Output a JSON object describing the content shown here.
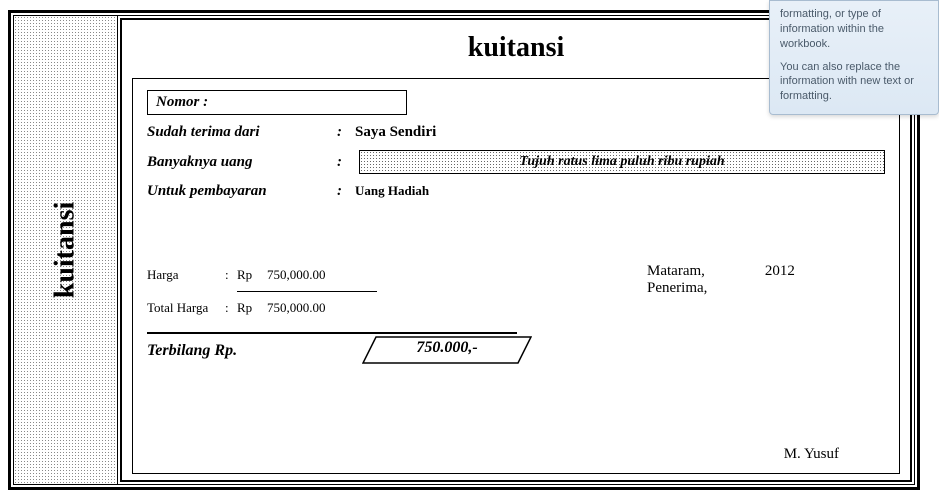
{
  "tooltip": {
    "line1": "formatting, or type of information within the workbook.",
    "line2": "You can also replace the information with new text or formatting."
  },
  "spine": {
    "title": "kuitansi"
  },
  "receipt": {
    "title": "kuitansi",
    "nomor_label": "Nomor :",
    "nomor_value": "",
    "received_from_label": "Sudah terima dari",
    "received_from_value": "Saya Sendiri",
    "amount_label": "Banyaknya uang",
    "amount_words": "Tujuh ratus lima puluh  ribu rupiah",
    "purpose_label": "Untuk pembayaran",
    "purpose_value": "Uang Hadiah",
    "price": {
      "harga_label": "Harga",
      "currency": "Rp",
      "harga_value": "750,000.00",
      "total_label": "Total Harga",
      "total_value": "750,000.00"
    },
    "signature": {
      "place": "Mataram,",
      "year": "2012",
      "role": "Penerima,",
      "name": "M. Yusuf"
    },
    "terbilang": {
      "label": "Terbilang  Rp.",
      "value": "750.000,-"
    }
  }
}
